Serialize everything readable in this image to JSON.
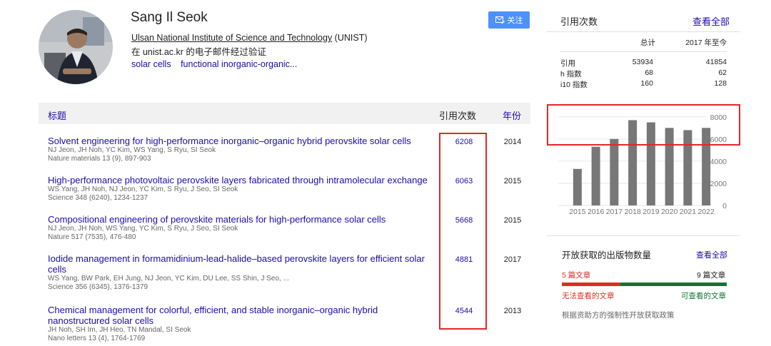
{
  "profile": {
    "name": "Sang Il Seok",
    "affiliation_link": "Ulsan National Institute of Science and Technology",
    "affiliation_suffix": " (UNIST)",
    "verified": "在 unist.ac.kr 的电子邮件经过验证",
    "interests": [
      "solar cells",
      "functional inorganic-organic..."
    ],
    "follow_label": "关注"
  },
  "table": {
    "col_title": "标题",
    "col_cites": "引用次数",
    "col_year": "年份",
    "rows": [
      {
        "title": "Solvent engineering for high-performance inorganic–organic hybrid perovskite solar cells",
        "authors": "NJ Jeon, JH Noh, YC Kim, WS Yang, S Ryu, SI Seok",
        "venue": "Nature materials 13 (9), 897-903",
        "cites": "6208",
        "year": "2014"
      },
      {
        "title": "High-performance photovoltaic perovskite layers fabricated through intramolecular exchange",
        "authors": "WS Yang, JH Noh, NJ Jeon, YC Kim, S Ryu, J Seo, SI Seok",
        "venue": "Science 348 (6240), 1234-1237",
        "cites": "6063",
        "year": "2015"
      },
      {
        "title": "Compositional engineering of perovskite materials for high-performance solar cells",
        "authors": "NJ Jeon, JH Noh, WS Yang, YC Kim, S Ryu, J Seo, SI Seok",
        "venue": "Nature 517 (7535), 476-480",
        "cites": "5668",
        "year": "2015"
      },
      {
        "title": "Iodide management in formamidinium-lead-halide–based perovskite layers for efficient solar cells",
        "authors": "WS Yang, BW Park, EH Jung, NJ Jeon, YC Kim, DU Lee, SS Shin, J Seo, ...",
        "venue": "Science 356 (6345), 1376-1379",
        "cites": "4881",
        "year": "2017"
      },
      {
        "title": "Chemical management for colorful, efficient, and stable inorganic–organic hybrid nanostructured solar cells",
        "authors": "JH Noh, SH Im, JH Heo, TN Mandal, SI Seok",
        "venue": "Nano letters 13 (4), 1764-1769",
        "cites": "4544",
        "year": "2013"
      }
    ]
  },
  "citations": {
    "title": "引用次数",
    "view_all": "查看全部",
    "col_total": "总计",
    "col_since": "2017 年至今",
    "rows": [
      {
        "label": "引用",
        "total": "53934",
        "since": "41854"
      },
      {
        "label": "h 指数",
        "total": "68",
        "since": "62"
      },
      {
        "label": "i10 指数",
        "total": "160",
        "since": "128"
      }
    ]
  },
  "chart_data": {
    "type": "bar",
    "categories": [
      "2015",
      "2016",
      "2017",
      "2018",
      "2019",
      "2020",
      "2021",
      "2022"
    ],
    "values": [
      3300,
      5300,
      6000,
      7700,
      7500,
      7000,
      6800,
      7000
    ],
    "yticks": [
      "0",
      "2000",
      "4000",
      "6000",
      "8000"
    ],
    "ylim": [
      0,
      8500
    ],
    "bar_color": "#777777"
  },
  "open_access": {
    "title": "开放获取的出版物数量",
    "view_all": "查看全部",
    "unavailable_count": "5 篇文章",
    "available_count": "9 篇文章",
    "unavailable_label": "无法查看的文章",
    "available_label": "可查看的文章",
    "unavailable_fraction": 0.357,
    "note": "根据资助方的强制性开放获取政策",
    "colors": {
      "unavailable": "#d93025",
      "available": "#137333"
    }
  }
}
